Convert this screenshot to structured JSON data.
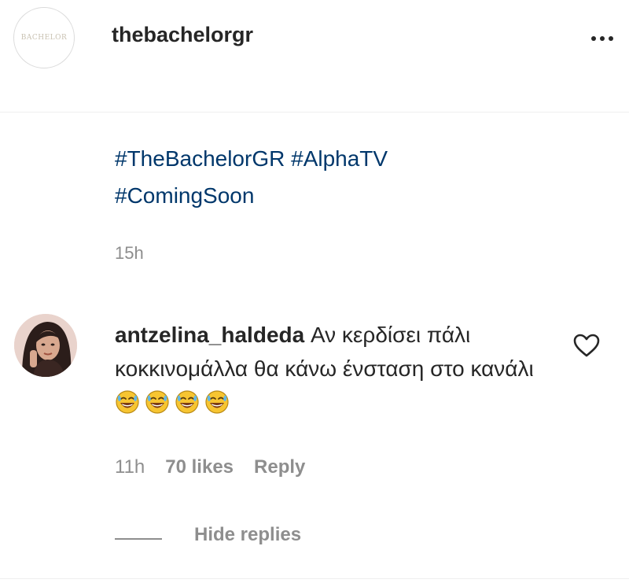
{
  "post": {
    "username": "thebachelorgr",
    "avatar_logo_text": "BACHELOR",
    "more_icon": "more-horizontal-icon"
  },
  "caption": {
    "hashtags": [
      "#TheBachelorGR",
      "#AlphaTV",
      "#ComingSoon"
    ],
    "time": "15h"
  },
  "comment": {
    "username": "antzelina_haldeda",
    "text": "Αν κερδίσει πάλι κοκκινομάλλα θα κάνω ένσταση στο κανάλι",
    "emoji_icon": "grinning-face-with-sweat-icon",
    "emoji_count": 4,
    "time": "11h",
    "likes": "70 likes",
    "reply_label": "Reply",
    "like_icon": "heart-outline-icon",
    "hide_replies_label": "Hide replies"
  },
  "colors": {
    "hashtag": "#00376b",
    "muted": "#8e8e8e",
    "text": "#262626"
  }
}
